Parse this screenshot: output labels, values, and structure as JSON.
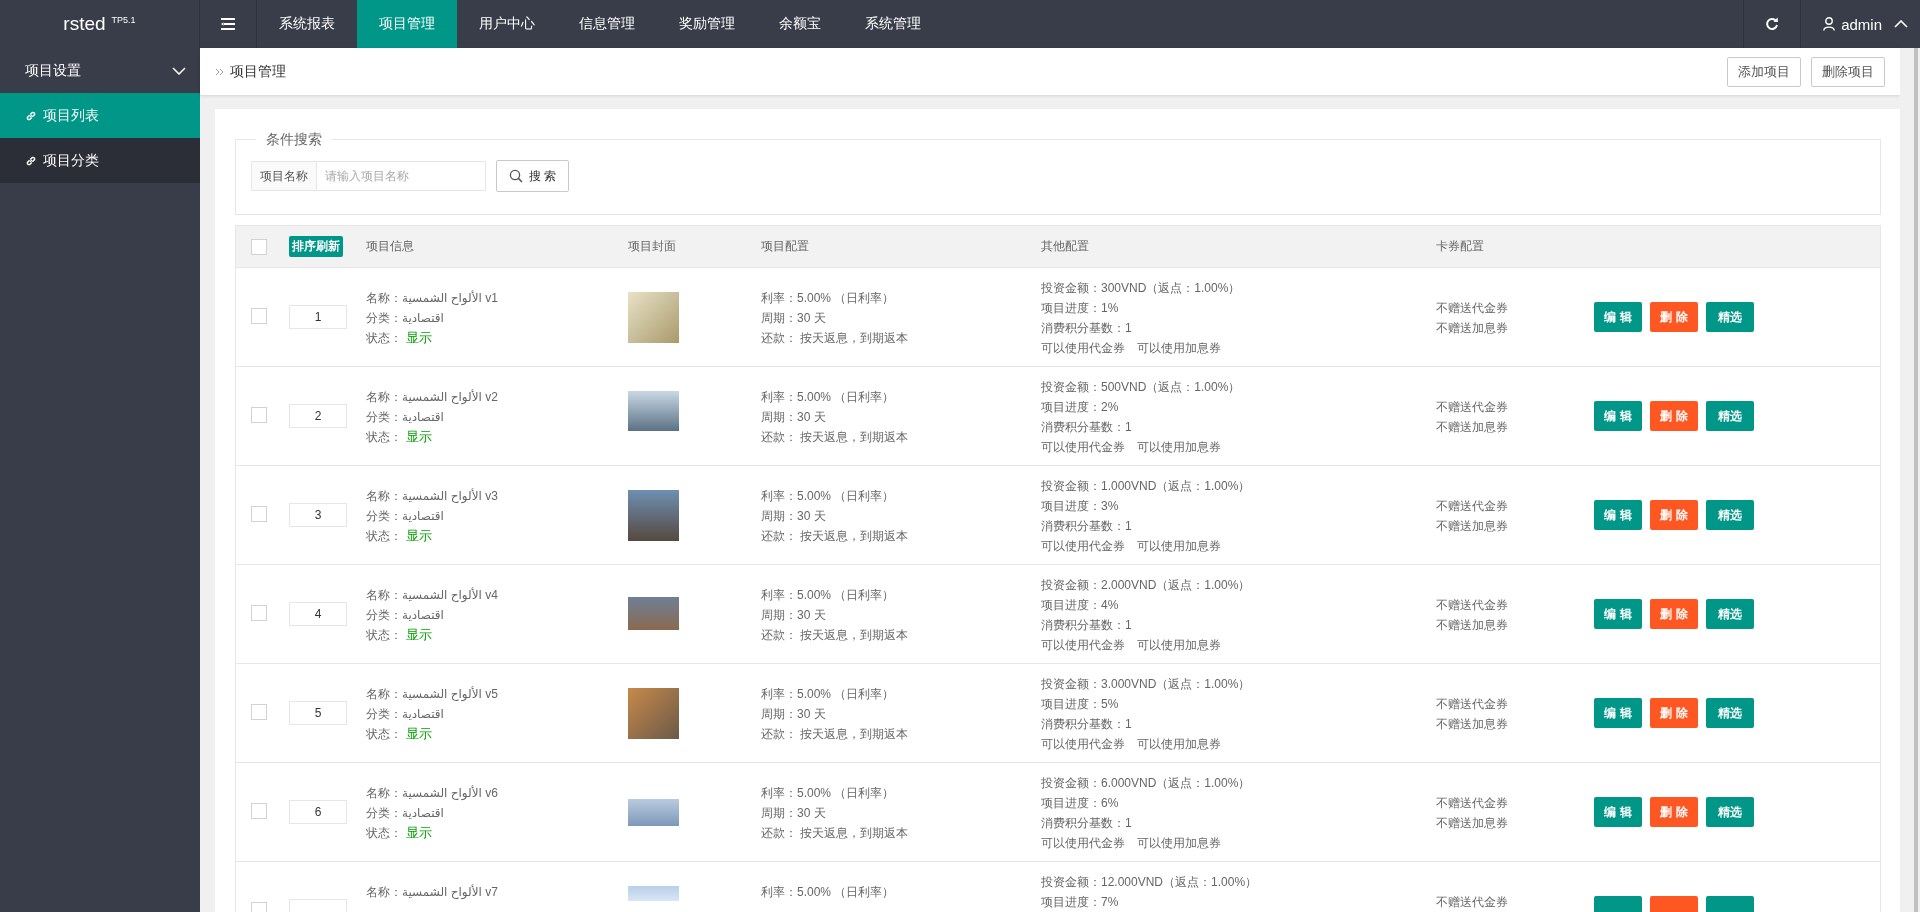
{
  "brand": {
    "name": "rsted",
    "version": "TP5.1"
  },
  "top_nav": {
    "items": [
      {
        "label": "系统报表",
        "selected": false
      },
      {
        "label": "项目管理",
        "selected": true
      },
      {
        "label": "用户中心",
        "selected": false
      },
      {
        "label": "信息管理",
        "selected": false
      },
      {
        "label": "奖励管理",
        "selected": false
      },
      {
        "label": "余额宝",
        "selected": false
      },
      {
        "label": "系统管理",
        "selected": false
      }
    ],
    "user": "admin"
  },
  "sidebar": {
    "group": {
      "label": "项目设置",
      "expanded": true
    },
    "items": [
      {
        "label": "项目列表",
        "selected": true
      },
      {
        "label": "项目分类",
        "selected": false
      }
    ]
  },
  "breadcrumb": "项目管理",
  "toolbar_buttons": [
    "添加项目",
    "删除项目"
  ],
  "search": {
    "legend": "条件搜索",
    "field_label": "项目名称",
    "placeholder": "请输入项目名称",
    "button": "搜 索"
  },
  "table": {
    "all_checked": false,
    "sort_button": "排序刷新",
    "columns": [
      "项目信息",
      "项目封面",
      "项目配置",
      "其他配置",
      "卡券配置"
    ],
    "rows": [
      {
        "checked": false,
        "sort": "1",
        "info": [
          "名称：الألواح الشمسية v1",
          "分类：اقتصادية"
        ],
        "status_label": "状态：",
        "status": "显示",
        "config": [
          "利率：5.00% （日利率）",
          "周期：30 天",
          "还款： 按天返息，到期返本"
        ],
        "other": [
          "投资金额：300VND（返点：1.00%）",
          "项目进度：1%",
          "消费积分基数：1"
        ],
        "coupons": [
          "可以使用代金券",
          "可以使用加息券"
        ],
        "card": [
          "不赠送代金券",
          "不赠送加息券"
        ],
        "buttons": [
          {
            "kind": "edit",
            "label": "编 辑"
          },
          {
            "kind": "delete",
            "label": "删 除"
          },
          {
            "kind": "pick",
            "label": "精选"
          }
        ]
      },
      {
        "checked": false,
        "sort": "2",
        "info": [
          "名称：الألواح الشمسية v2",
          "分类：اقتصادية"
        ],
        "status_label": "状态：",
        "status": "显示",
        "config": [
          "利率：5.00% （日利率）",
          "周期：30 天",
          "还款： 按天返息，到期返本"
        ],
        "other": [
          "投资金额：500VND（返点：1.00%）",
          "项目进度：2%",
          "消费积分基数：1"
        ],
        "coupons": [
          "可以使用代金券",
          "可以使用加息券"
        ],
        "card": [
          "不赠送代金券",
          "不赠送加息券"
        ],
        "buttons": [
          {
            "kind": "edit",
            "label": "编 辑"
          },
          {
            "kind": "delete",
            "label": "删 除"
          },
          {
            "kind": "pick",
            "label": "精选"
          }
        ]
      },
      {
        "checked": false,
        "sort": "3",
        "info": [
          "名称：الألواح الشمسية v3",
          "分类：اقتصادية"
        ],
        "status_label": "状态：",
        "status": "显示",
        "config": [
          "利率：5.00% （日利率）",
          "周期：30 天",
          "还款： 按天返息，到期返本"
        ],
        "other": [
          "投资金额：1.000VND（返点：1.00%）",
          "项目进度：3%",
          "消费积分基数：1"
        ],
        "coupons": [
          "可以使用代金券",
          "可以使用加息券"
        ],
        "card": [
          "不赠送代金券",
          "不赠送加息券"
        ],
        "buttons": [
          {
            "kind": "edit",
            "label": "编 辑"
          },
          {
            "kind": "delete",
            "label": "删 除"
          },
          {
            "kind": "pick",
            "label": "精选"
          }
        ]
      },
      {
        "checked": false,
        "sort": "4",
        "info": [
          "名称：الألواح الشمسية v4",
          "分类：اقتصادية"
        ],
        "status_label": "状态：",
        "status": "显示",
        "config": [
          "利率：5.00% （日利率）",
          "周期：30 天",
          "还款： 按天返息，到期返本"
        ],
        "other": [
          "投资金额：2.000VND（返点：1.00%）",
          "项目进度：4%",
          "消费积分基数：1"
        ],
        "coupons": [
          "可以使用代金券",
          "可以使用加息券"
        ],
        "card": [
          "不赠送代金券",
          "不赠送加息券"
        ],
        "buttons": [
          {
            "kind": "edit",
            "label": "编 辑"
          },
          {
            "kind": "delete",
            "label": "删 除"
          },
          {
            "kind": "pick",
            "label": "精选"
          }
        ]
      },
      {
        "checked": false,
        "sort": "5",
        "info": [
          "名称：الألواح الشمسية v5",
          "分类：اقتصادية"
        ],
        "status_label": "状态：",
        "status": "显示",
        "config": [
          "利率：5.00% （日利率）",
          "周期：30 天",
          "还款： 按天返息，到期返本"
        ],
        "other": [
          "投资金额：3.000VND（返点：1.00%）",
          "项目进度：5%",
          "消费积分基数：1"
        ],
        "coupons": [
          "可以使用代金券",
          "可以使用加息券"
        ],
        "card": [
          "不赠送代金券",
          "不赠送加息券"
        ],
        "buttons": [
          {
            "kind": "edit",
            "label": "编 辑"
          },
          {
            "kind": "delete",
            "label": "删 除"
          },
          {
            "kind": "pick",
            "label": "精选"
          }
        ]
      },
      {
        "checked": false,
        "sort": "6",
        "info": [
          "名称：الألواح الشمسية v6",
          "分类：اقتصادية"
        ],
        "status_label": "状态：",
        "status": "显示",
        "config": [
          "利率：5.00% （日利率）",
          "周期：30 天",
          "还款： 按天返息，到期返本"
        ],
        "other": [
          "投资金额：6.000VND（返点：1.00%）",
          "项目进度：6%",
          "消费积分基数：1"
        ],
        "coupons": [
          "可以使用代金券",
          "可以使用加息券"
        ],
        "card": [
          "不赠送代金券",
          "不赠送加息券"
        ],
        "buttons": [
          {
            "kind": "edit",
            "label": "编 辑"
          },
          {
            "kind": "delete",
            "label": "删 除"
          },
          {
            "kind": "pick",
            "label": "精选"
          }
        ]
      },
      {
        "checked": false,
        "info": [
          "名称：الألواح الشمسية v7"
        ],
        "config": [
          "利率：5.00% （日利率）"
        ],
        "other": [
          "投资金额：12.000VND（返点：1.00%）",
          "项目进度：7%"
        ],
        "card": [
          "不赠送代金券"
        ],
        "buttons": [
          {
            "kind": "edit"
          },
          {
            "kind": "delete"
          },
          {
            "kind": "pick"
          }
        ]
      }
    ]
  }
}
